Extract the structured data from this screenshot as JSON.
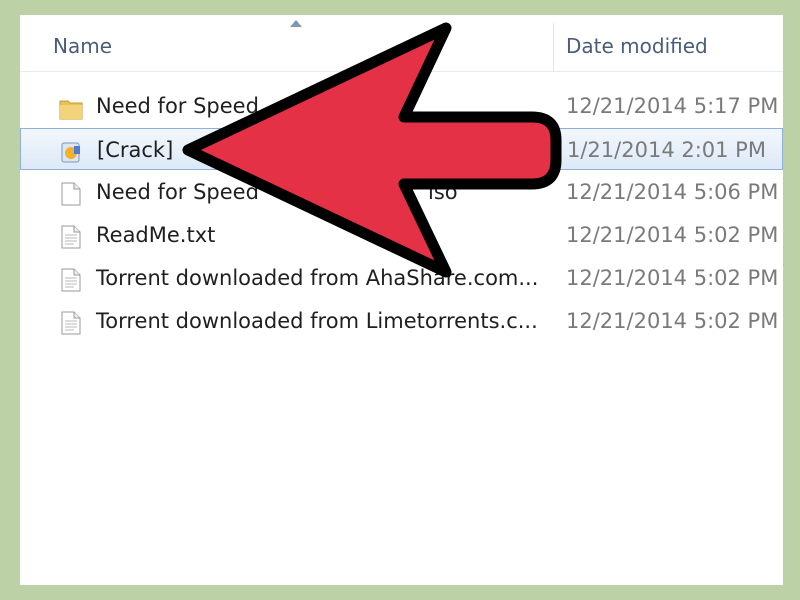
{
  "explorer": {
    "columns": {
      "name": "Name",
      "date_modified": "Date modified"
    },
    "files": [
      {
        "name": "Need for Speed",
        "date": "12/21/2014 5:17 PM",
        "icon": "folder-icon",
        "selected": false
      },
      {
        "name": "[Crack]",
        "date": "1/21/2014 2:01 PM",
        "icon": "setup-installer-icon",
        "selected": true
      },
      {
        "name": "Need for Speed",
        "name_suffix": "iso",
        "date": "12/21/2014 5:06 PM",
        "icon": "disc-image-file-icon",
        "selected": false
      },
      {
        "name": "ReadMe.txt",
        "date": "12/21/2014 5:02 PM",
        "icon": "text-file-icon",
        "selected": false
      },
      {
        "name": "Torrent downloaded from AhaShare.com...",
        "date": "12/21/2014 5:02 PM",
        "icon": "text-file-icon",
        "selected": false
      },
      {
        "name": "Torrent downloaded from Limetorrents.c...",
        "date": "12/21/2014 5:02 PM",
        "icon": "text-file-icon",
        "selected": false
      }
    ]
  },
  "colors": {
    "background": "#bcd2a6",
    "arrow_fill": "#e53145",
    "arrow_outline": "#000000",
    "selection": "#dde9f7",
    "header_text": "#4a5d78"
  }
}
